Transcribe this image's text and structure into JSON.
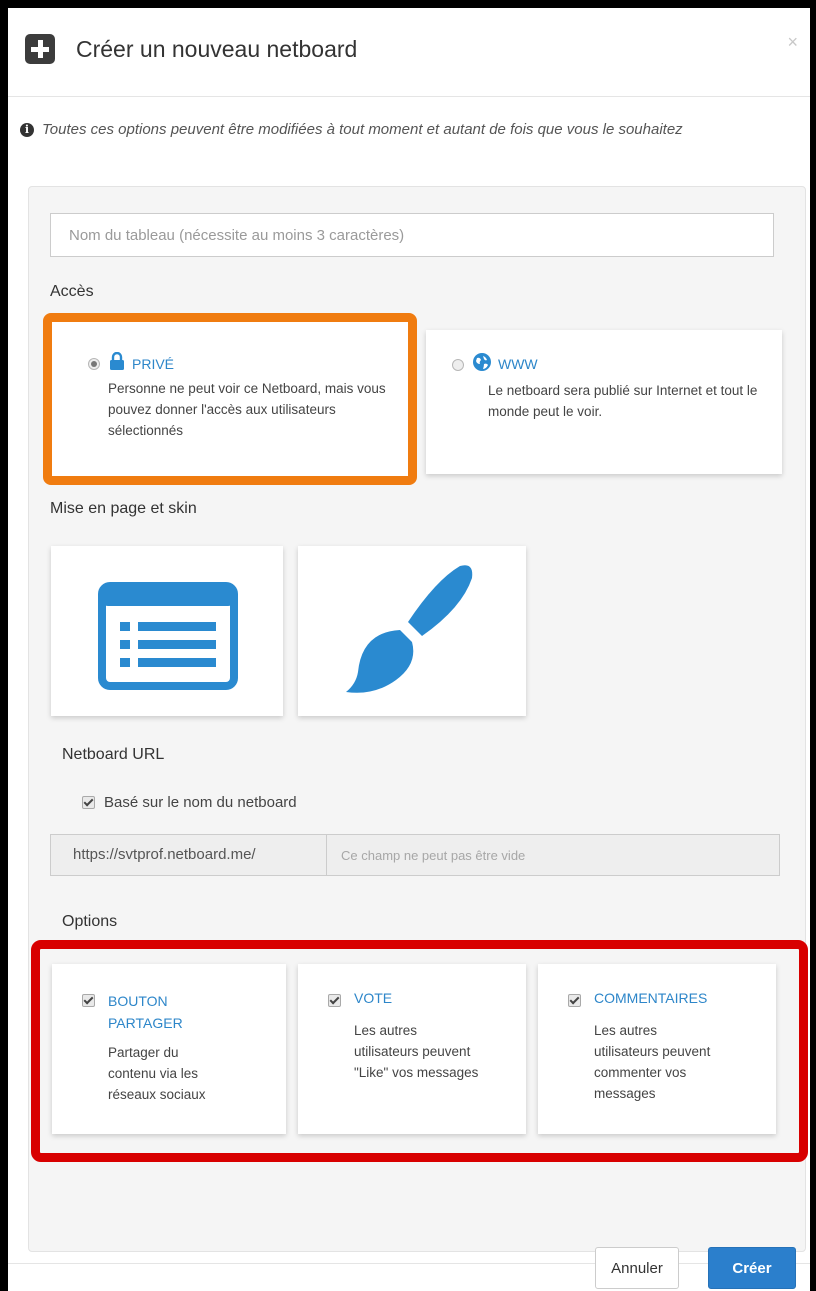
{
  "dialog": {
    "title": "Créer un nouveau netboard",
    "close_symbol": "×",
    "info_text": "Toutes ces options peuvent être modifiées à tout moment et autant de fois que vous le souhaitez",
    "info_icon_glyph": "i"
  },
  "name_input": {
    "placeholder": "Nom du tableau (nécessite au moins 3 caractères)",
    "value": ""
  },
  "access": {
    "label": "Accès",
    "options": [
      {
        "title": "PRIVÉ",
        "desc": "Personne ne peut voir ce Netboard, mais vous pouvez donner l'accès aux utilisateurs sélectionnés",
        "selected": true,
        "icon": "lock-icon"
      },
      {
        "title": "WWW",
        "desc": "Le netboard sera publié sur Internet et tout le monde peut le voir.",
        "selected": false,
        "icon": "globe-icon"
      }
    ]
  },
  "layout": {
    "label": "Mise en page et skin",
    "cards": [
      {
        "icon": "layout-list-icon"
      },
      {
        "icon": "paintbrush-icon"
      }
    ]
  },
  "url": {
    "label": "Netboard URL",
    "checkbox_label": "Basé sur le nom du netboard",
    "checkbox_checked": true,
    "prefix": "https://svtprof.netboard.me/",
    "placeholder": "Ce champ ne peut pas être vide"
  },
  "options": {
    "label": "Options",
    "items": [
      {
        "title": "BOUTON PARTAGER",
        "desc": "Partager du contenu via les réseaux sociaux",
        "checked": true
      },
      {
        "title": "VOTE",
        "desc": "Les autres utilisateurs peuvent \"Like\" vos messages",
        "checked": true
      },
      {
        "title": "COMMENTAIRES",
        "desc": "Les autres utilisateurs peuvent commenter vos messages",
        "checked": true
      }
    ]
  },
  "footer": {
    "cancel_label": "Annuler",
    "create_label": "Créer"
  },
  "colors": {
    "accent": "#2b7fcc",
    "icon_blue": "#2a8ad0",
    "highlight_orange": "#f07c10",
    "highlight_red": "#d80000"
  }
}
